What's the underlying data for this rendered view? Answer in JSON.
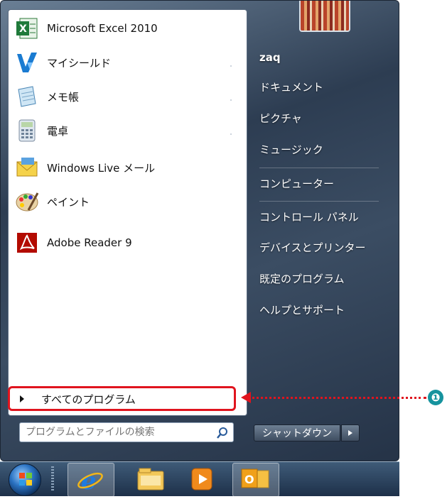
{
  "start_menu": {
    "pinned_programs": [
      {
        "label": "Microsoft Excel 2010",
        "icon": "excel-icon"
      },
      {
        "label": "マイシールド",
        "icon": "myshield-icon"
      },
      {
        "label": "メモ帳",
        "icon": "notepad-icon"
      },
      {
        "label": "電卓",
        "icon": "calculator-icon"
      },
      {
        "label": "Windows Live メール",
        "icon": "mail-icon"
      },
      {
        "label": "ペイント",
        "icon": "paint-icon"
      },
      {
        "label": "Adobe Reader 9",
        "icon": "adobe-reader-icon"
      }
    ],
    "all_programs_label": "すべてのプログラム",
    "search_placeholder": "プログラムとファイルの検索",
    "user_name": "zaq",
    "right_items": [
      {
        "label": "ドキュメント"
      },
      {
        "label": "ピクチャ"
      },
      {
        "label": "ミュージック"
      },
      {
        "label": "コンピューター"
      },
      {
        "label": "コントロール パネル"
      },
      {
        "label": "デバイスとプリンター"
      },
      {
        "label": "既定のプログラム"
      },
      {
        "label": "ヘルプとサポート"
      }
    ],
    "shutdown_label": "シャットダウン"
  },
  "annotation": {
    "badge": "❶",
    "color": "#e0141e",
    "badge_color": "#16939e"
  },
  "taskbar": {
    "items": [
      "start-orb",
      "internet-explorer-icon",
      "windows-explorer-icon",
      "media-player-icon",
      "outlook-icon"
    ]
  }
}
